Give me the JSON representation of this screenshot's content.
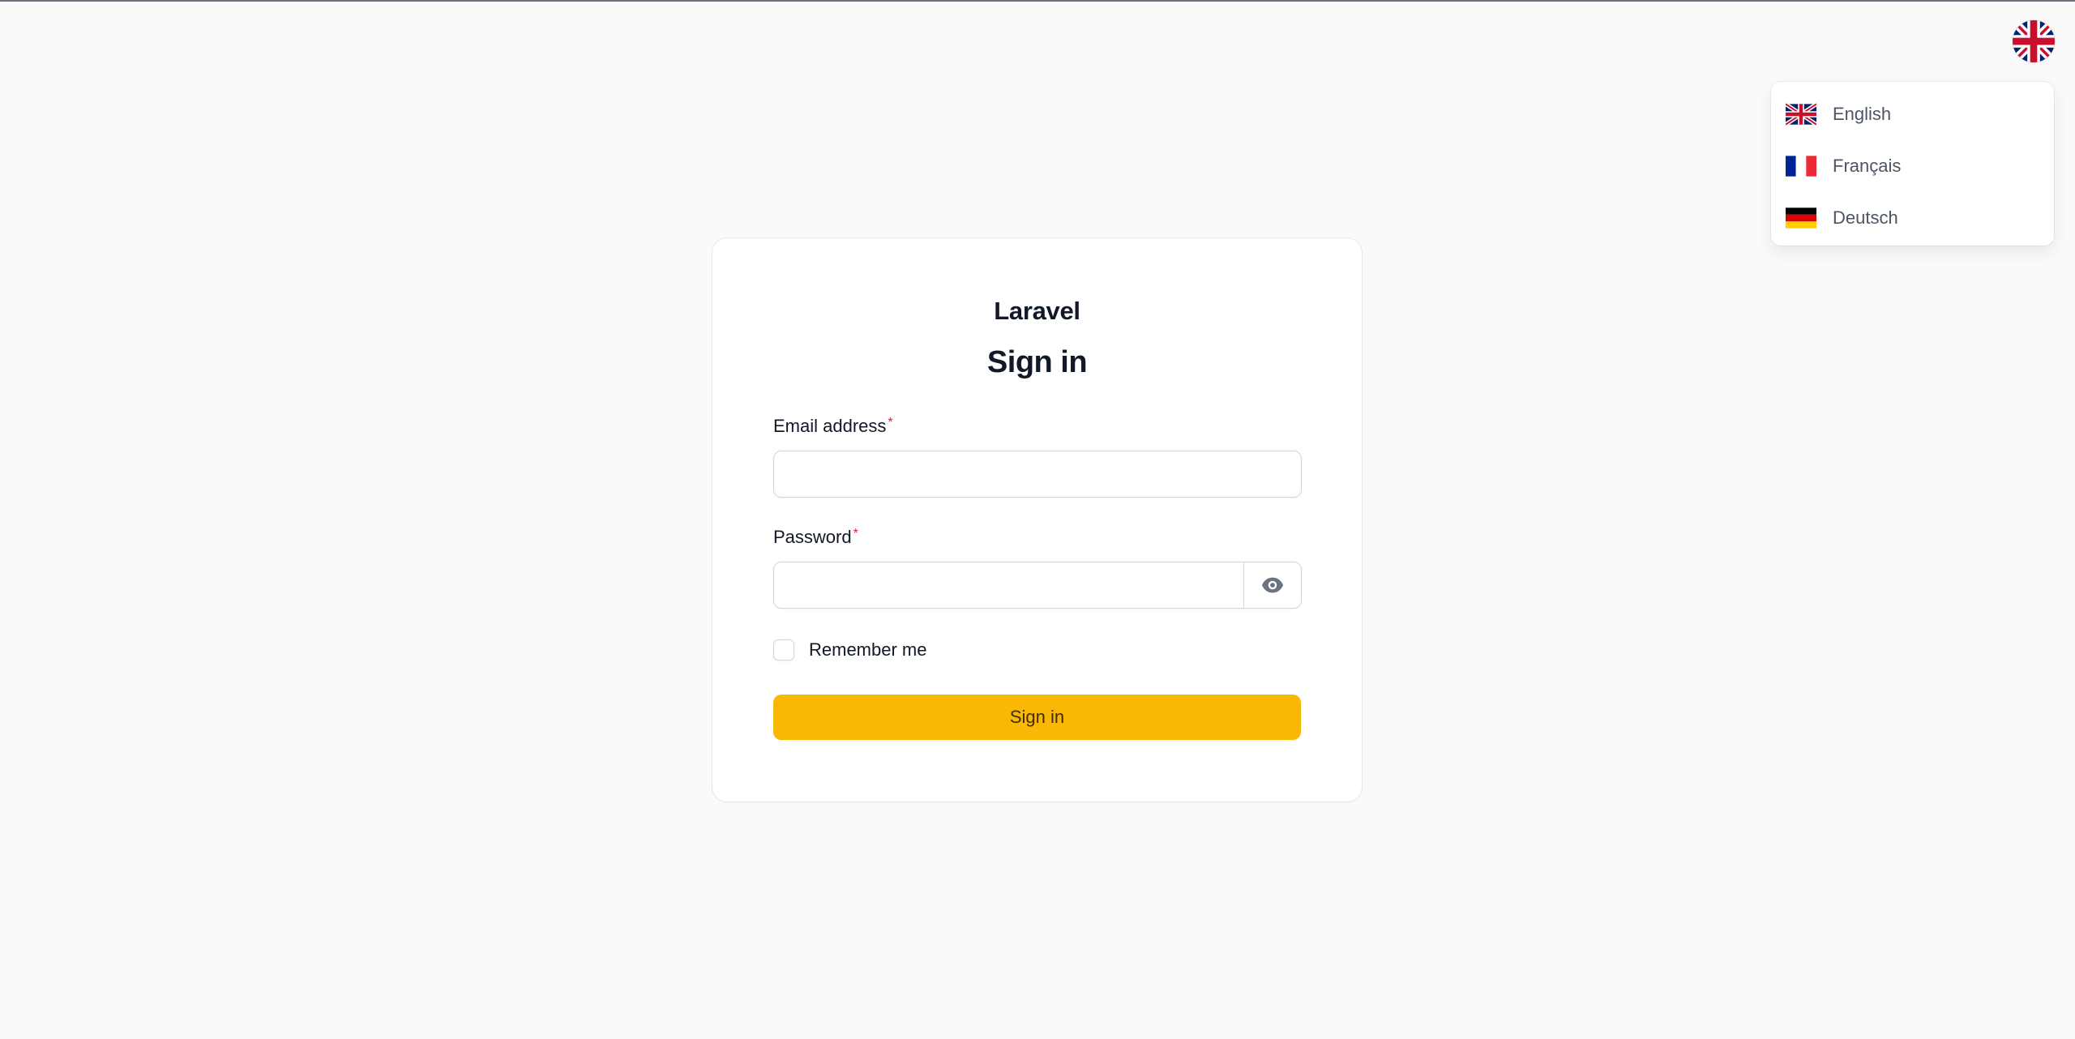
{
  "language_switcher": {
    "current_flag_icon": "uk-flag-icon",
    "options": [
      {
        "label": "English",
        "flag_icon": "uk-flag-icon"
      },
      {
        "label": "Français",
        "flag_icon": "france-flag-icon"
      },
      {
        "label": "Deutsch",
        "flag_icon": "germany-flag-icon"
      }
    ]
  },
  "login": {
    "brand": "Laravel",
    "heading": "Sign in",
    "email": {
      "label": "Email address",
      "required_mark": "*",
      "value": "",
      "placeholder": ""
    },
    "password": {
      "label": "Password",
      "required_mark": "*",
      "value": "",
      "placeholder": "",
      "toggle_icon": "eye-icon"
    },
    "remember": {
      "label": "Remember me",
      "checked": false
    },
    "submit_label": "Sign in"
  },
  "colors": {
    "background": "#fafafa",
    "primary_button": "#fbb705",
    "required_mark": "#dc2626"
  }
}
